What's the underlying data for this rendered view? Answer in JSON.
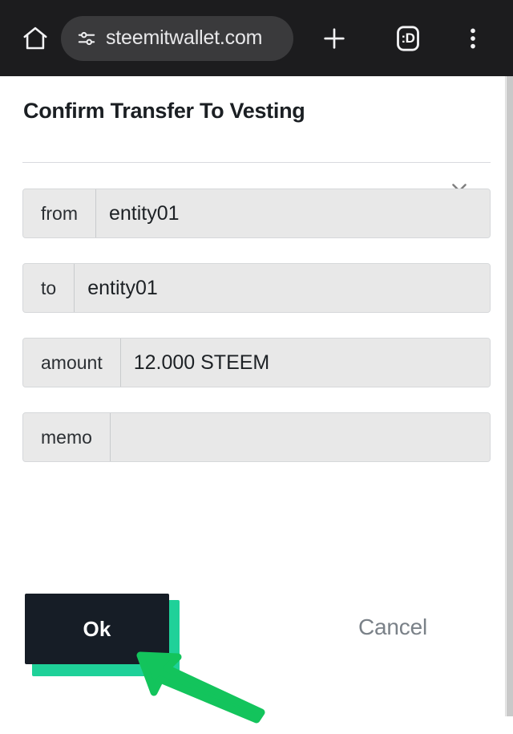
{
  "browser": {
    "home_icon": "home-icon",
    "site_info_icon": "tune-sliders-icon",
    "url": "steemitwallet.com",
    "new_tab_icon": "plus-icon",
    "tab_count": ":D",
    "menu_icon": "three-dot-menu-icon"
  },
  "dialog": {
    "title": "Confirm Transfer To Vesting",
    "close_icon": "close-icon",
    "fields": [
      {
        "label": "from",
        "value": "entity01"
      },
      {
        "label": "to",
        "value": "entity01"
      },
      {
        "label": "amount",
        "value": "12.000 STEEM"
      },
      {
        "label": "memo",
        "value": ""
      }
    ],
    "actions": {
      "ok_label": "Ok",
      "cancel_label": "Cancel"
    }
  },
  "annotation": {
    "arrow_icon": "arrow-pointer-icon",
    "arrow_color": "#13c45c",
    "points_to": "Ok"
  },
  "colors": {
    "toolbar_background": "#1c1c1e",
    "url_pill_background": "#3a3a3c",
    "page_background": "#ffffff",
    "field_background": "#e9e9e9",
    "field_border": "#d6d8da",
    "ok_button_background": "#161d26",
    "ok_button_shadow": "#1fd199",
    "cancel_text": "#7a8188",
    "title_text": "#1b1f23",
    "arrow_green": "#13c45c"
  }
}
